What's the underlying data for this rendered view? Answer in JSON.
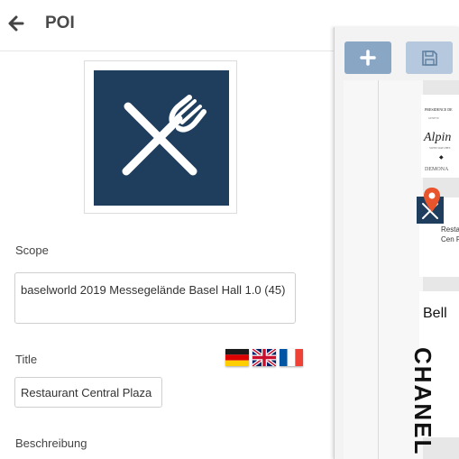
{
  "header": {
    "title": "POI",
    "back_icon": "arrow-left-icon"
  },
  "poi_image": {
    "icon": "fork-knife-icon",
    "background_color": "#1f3d5c"
  },
  "form": {
    "scope_label": "Scope",
    "scope_value": "baselworld 2019 Messegelände Basel Hall 1.0 (45)",
    "title_label": "Title",
    "title_value": "Restaurant Central Plaza",
    "description_label": "Beschreibung",
    "languages": [
      {
        "code": "de",
        "icon": "flag-germany-icon"
      },
      {
        "code": "en",
        "icon": "flag-uk-icon"
      },
      {
        "code": "fr",
        "icon": "flag-france-icon"
      }
    ]
  },
  "map": {
    "add_icon": "plus-icon",
    "save_icon": "floppy-disk-icon",
    "add_color": "#8aa6c5",
    "save_color": "#b5c8dd",
    "booth_texts": {
      "b1_line1": "PRESIDENCE DE",
      "b1_line2": "GENEVE",
      "b1_brand": "Alpin",
      "b1_line3": "SWISS WATCHES",
      "b1_diamond": "◆",
      "b1_bottom": "DEMONA",
      "b2_text": "Resta Cen Pla",
      "b3_brand": "Bell",
      "b4_brand": "CHANEL"
    }
  }
}
